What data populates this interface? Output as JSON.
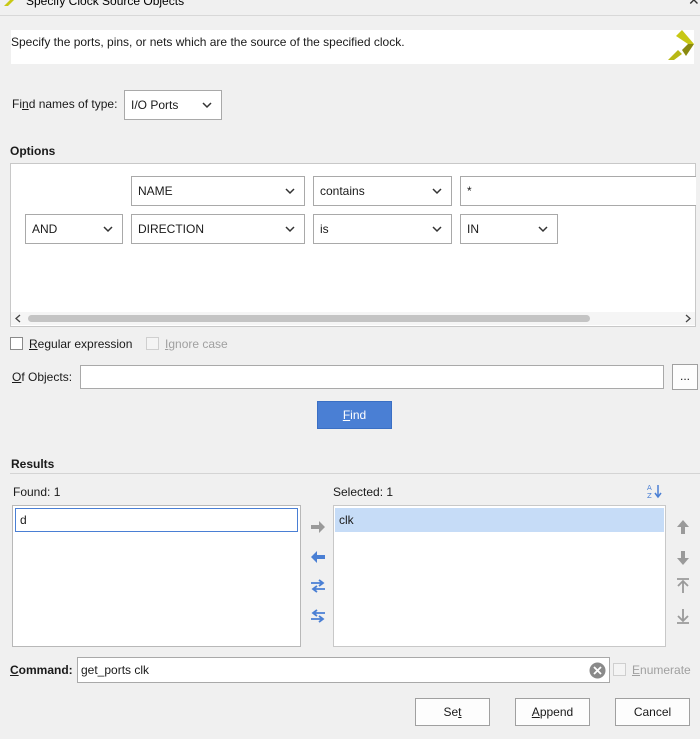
{
  "window": {
    "title": "Specify Clock Source Objects"
  },
  "header": {
    "description": "Specify the ports, pins, or nets which are the source of the specified clock."
  },
  "find_names": {
    "label": "Find names of type:",
    "value": "I/O Ports"
  },
  "options": {
    "label": "Options",
    "row1": {
      "property": "NAME",
      "operator": "contains",
      "value": "*"
    },
    "row2": {
      "logic": "AND",
      "property": "DIRECTION",
      "operator": "is",
      "value": "IN"
    }
  },
  "checkboxes": {
    "regex_label": "Regular expression",
    "ignore_case_label": "Ignore case"
  },
  "of_objects": {
    "label": "Of Objects:",
    "value": "",
    "browse_label": "..."
  },
  "find_button": "Find",
  "results": {
    "label": "Results",
    "found_label": "Found: 1",
    "found_items": [
      "d"
    ],
    "selected_label": "Selected: 1",
    "selected_items": [
      "clk"
    ]
  },
  "command": {
    "label": "Command:",
    "value": "get_ports clk",
    "enumerate_label": "Enumerate"
  },
  "buttons": {
    "set": "Set",
    "append": "Append",
    "cancel": "Cancel"
  },
  "colors": {
    "primary": "#4a7fd4",
    "selection": "#c6dcf7",
    "arrow": "#4a7fd4",
    "logo": "#c8c814"
  },
  "icons": [
    "xilinx-logo-icon",
    "close-icon",
    "chevron-down-icon",
    "sort-az-icon",
    "arrow-right-icon",
    "arrow-left-icon",
    "move-all-right-icon",
    "move-all-left-icon",
    "move-up-icon",
    "move-down-icon",
    "move-top-icon",
    "move-bottom-icon",
    "clear-icon"
  ]
}
